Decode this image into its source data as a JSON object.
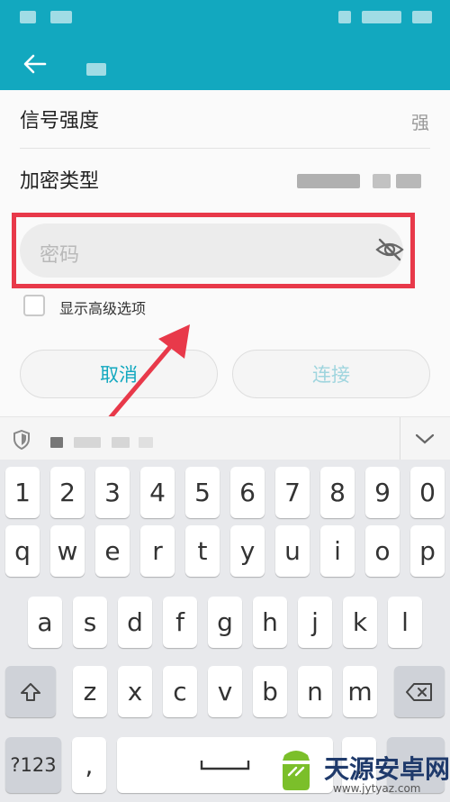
{
  "wifi_settings": {
    "signal_strength_label": "信号强度",
    "signal_strength_value": "强",
    "encryption_type_label": "加密类型",
    "password_placeholder": "密码",
    "show_advanced_label": "显示高级选项",
    "cancel_button": "取消",
    "connect_button": "连接"
  },
  "keyboard": {
    "number_row": [
      "1",
      "2",
      "3",
      "4",
      "5",
      "6",
      "7",
      "8",
      "9",
      "0"
    ],
    "row1": [
      "q",
      "w",
      "e",
      "r",
      "t",
      "y",
      "u",
      "i",
      "o",
      "p"
    ],
    "row2": [
      "a",
      "s",
      "d",
      "f",
      "g",
      "h",
      "j",
      "k",
      "l"
    ],
    "row3": [
      "z",
      "x",
      "c",
      "v",
      "b",
      "n",
      "m"
    ],
    "symbol_key": "?123",
    "comma_key": ",",
    "period_key": "."
  },
  "watermark": {
    "title": "天源安卓网",
    "url": "www.jytyaz.com"
  },
  "colors": {
    "primary": "#12a8bf",
    "highlight": "#e8394a",
    "button_text": "#12a8bf"
  }
}
